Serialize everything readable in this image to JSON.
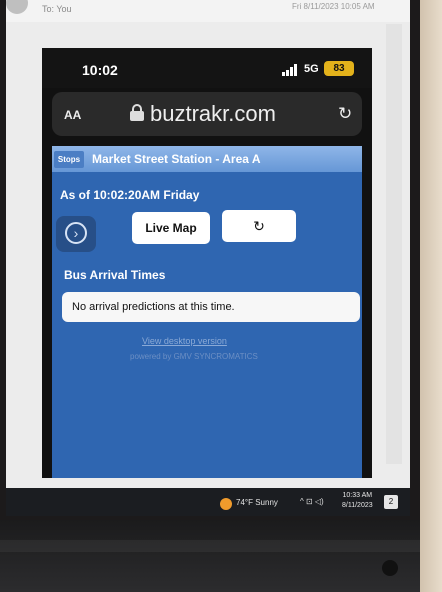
{
  "email": {
    "to": "To: You",
    "date": "Fri 8/11/2023 10:05 AM"
  },
  "phone_status": {
    "time": "10:02",
    "network": "5G",
    "battery": "83"
  },
  "browser": {
    "text_size_label": "AA",
    "domain": "buztrakr.com",
    "reload_icon": "reload-icon",
    "lock_icon": "lock-icon"
  },
  "page": {
    "stops_tab": "Stops",
    "station_title": "Market Street Station - Area A",
    "as_of": "As of 10:02:20AM Friday",
    "live_map_label": "Live Map",
    "refresh_icon": "↻",
    "arrivals_heading": "Bus Arrival Times",
    "no_predictions": "No arrival predictions at this time.",
    "desktop_link": "View desktop version",
    "powered_by": "powered by GMV SYNCROMATICS"
  },
  "taskbar": {
    "weather": "74°F  Sunny",
    "tray_icons": "^ ⊡ ◁)",
    "time": "10:33 AM",
    "date": "8/11/2023",
    "notification_count": "2"
  },
  "colors": {
    "page_blue": "#2f66b1",
    "title_gradient": "#8fb6e8",
    "battery": "#e3b21b"
  }
}
